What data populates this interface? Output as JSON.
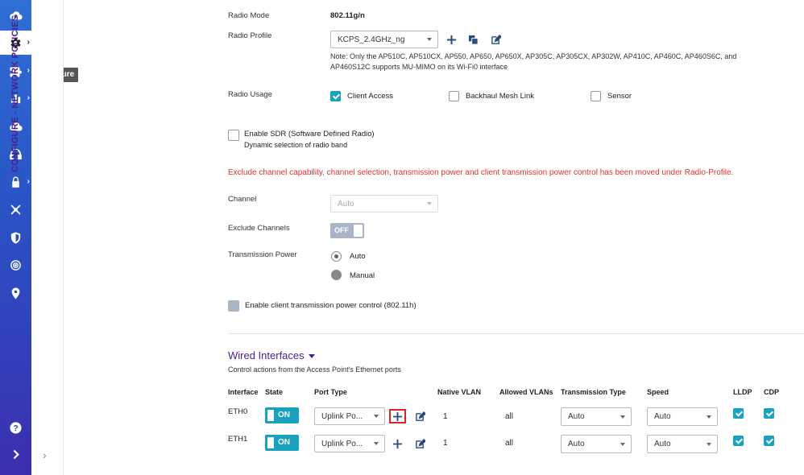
{
  "sidebar": {
    "tooltip": "Configure",
    "policy_label": "CONFIGURE - NETWORK POLICIES"
  },
  "radio": {
    "mode_label": "Radio Mode",
    "mode_value": "802.11g/n",
    "profile_label": "Radio Profile",
    "profile_value": "KCPS_2.4GHz_ng",
    "note": "Note: Only the AP510C, AP510CX, AP550, AP650, AP650X, AP305C, AP305CX, AP302W, AP410C, AP460C, AP460S6C, and AP460S12C supports MU-MIMO on its Wi-Fi0 interface",
    "usage_label": "Radio Usage",
    "usage_client": "Client Access",
    "usage_backhaul": "Backhaul Mesh Link",
    "usage_sensor": "Sensor",
    "sdr_label": "Enable SDR (Software Defined Radio)",
    "sdr_sub": "Dynamic selection of radio band",
    "warning": "Exclude channel capability, channel selection, transmission power and client transmission power control has been moved under Radio-Profile.",
    "channel_label": "Channel",
    "channel_value": "Auto",
    "exclude_label": "Exclude Channels",
    "exclude_toggle": "OFF",
    "power_label": "Transmission Power",
    "power_auto": "Auto",
    "power_manual": "Manual",
    "client_power_label": "Enable client transmission power control (802.11h)"
  },
  "wired": {
    "title": "Wired Interfaces",
    "subtitle": "Control actions from the Access Point's Ethernet ports",
    "headers": {
      "interface": "Interface",
      "state": "State",
      "port_type": "Port Type",
      "native_vlan": "Native VLAN",
      "allowed_vlans": "Allowed VLANs",
      "transmission_type": "Transmission Type",
      "speed": "Speed",
      "lldp": "LLDP",
      "cdp": "CDP"
    },
    "rows": [
      {
        "name": "ETH0",
        "state": "ON",
        "port_type": "Uplink Po...",
        "native_vlan": "1",
        "allowed_vlans": "all",
        "transmission_type": "Auto",
        "speed": "Auto"
      },
      {
        "name": "ETH1",
        "state": "ON",
        "port_type": "Uplink Po...",
        "native_vlan": "1",
        "allowed_vlans": "all",
        "transmission_type": "Auto",
        "speed": "Auto"
      }
    ]
  },
  "colors": {
    "accent": "#17a2c0",
    "brand_purple": "#4a1e8c",
    "warning_red": "#e03131"
  }
}
